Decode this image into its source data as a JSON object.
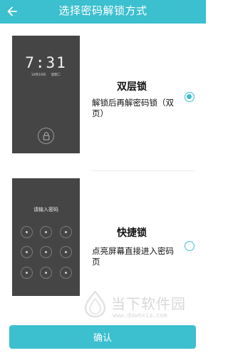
{
  "header": {
    "title": "选择密码解锁方式",
    "back_icon": "arrow-left-icon"
  },
  "options": [
    {
      "title": "双层锁",
      "description": "解锁后再解密码锁（双页）",
      "selected": true,
      "preview": {
        "time": "7:31",
        "date": "10月10日",
        "weekday": "星期二",
        "icons": [
          "lock-icon",
          "camera-icon"
        ]
      }
    },
    {
      "title": "快捷锁",
      "description": "点亮屏幕直接进入密码页",
      "selected": false,
      "preview": {
        "prompt": "请输入密码",
        "keypad_dots": 9
      }
    }
  ],
  "confirm_label": "确认",
  "watermark": {
    "text": "当下软件园",
    "url": "www.downxia.com"
  },
  "colors": {
    "accent": "#3cbfce",
    "preview_bg": "#454545"
  }
}
